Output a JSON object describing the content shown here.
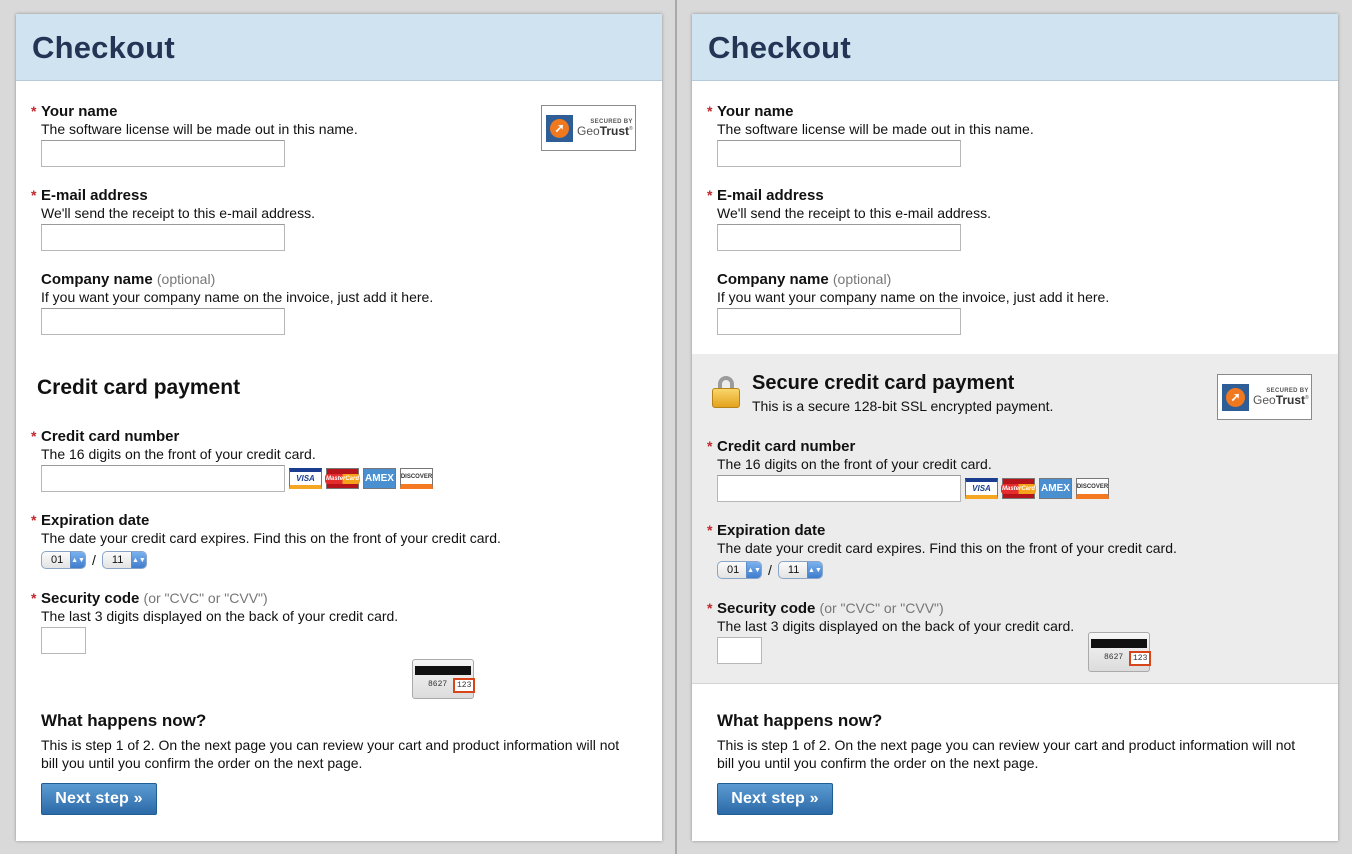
{
  "checkout": {
    "title": "Checkout",
    "name_field": {
      "label": "Your name",
      "help": "The software license will be made out in this name.",
      "value": ""
    },
    "email_field": {
      "label": "E-mail address",
      "help": "We'll send the receipt to this e-mail address.",
      "value": ""
    },
    "company_field": {
      "label": "Company name",
      "optional": "(optional)",
      "help": "If you want your company name on the invoice, just add it here.",
      "value": ""
    },
    "payment_title_left": "Credit card payment",
    "payment_title_right": "Secure credit card payment",
    "secure_subtitle": "This is a secure 128-bit SSL encrypted payment.",
    "card_number_field": {
      "label": "Credit card number",
      "help": "The 16 digits on the front of your credit card.",
      "value": ""
    },
    "card_brands": [
      "VISA",
      "MasterCard",
      "AMEX",
      "DISCOVER"
    ],
    "expiration_field": {
      "label": "Expiration date",
      "help": "The date your credit card expires. Find this on the front of your credit card.",
      "month": "01",
      "separator": "/",
      "year": "11"
    },
    "security_field": {
      "label": "Security code",
      "optional": "(or \"CVC\" or \"CVV\")",
      "help": "The last 3 digits displayed on the back of your credit card.",
      "card_number_sample": "8627",
      "card_code_sample": "123",
      "value": ""
    },
    "what_next": {
      "title": "What happens now?",
      "text": "This is step 1 of 2. On the next page you can review your cart and product information will not bill you until you confirm the order on the next page."
    },
    "next_button": "Next step »",
    "required_mark": "*",
    "badge": {
      "small": "SECURED BY",
      "brand_a": "Geo",
      "brand_b": "Trust",
      "mark": "®",
      "icon": "geotrust-logo-icon"
    },
    "colors": {
      "header_bg": "#d0e3f1",
      "title": "#223555",
      "required": "#c0272d",
      "button": "#2c6aa8",
      "secure_bg": "#ececec"
    }
  }
}
